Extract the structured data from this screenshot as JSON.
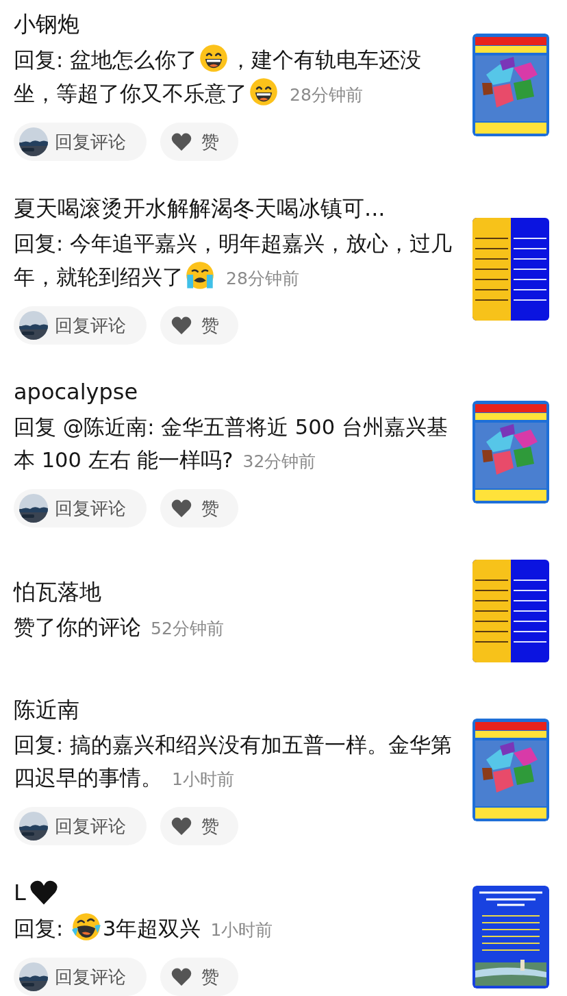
{
  "notifications": [
    {
      "name": [
        {
          "kind": "text",
          "text": "小钢炮"
        }
      ],
      "body": [
        {
          "kind": "text",
          "text": "回复: 盆地怎么你了"
        },
        {
          "kind": "grin"
        },
        {
          "kind": "text",
          "text": "，建个有轨电车还没坐，等超了你又不乐意了"
        },
        {
          "kind": "grin"
        }
      ],
      "time": "28分钟前",
      "actions": {
        "reply": "回复评论",
        "like": "赞"
      },
      "thumb": {
        "kind": "map"
      }
    },
    {
      "name": [
        {
          "kind": "text",
          "text": "夏天喝滚烫开水解解渴冬天喝冰镇可..."
        }
      ],
      "body": [
        {
          "kind": "text",
          "text": "回复: 今年追平嘉兴，明年超嘉兴，放心，过几年，就轮到绍兴了"
        },
        {
          "kind": "sob"
        }
      ],
      "time": "28分钟前",
      "actions": {
        "reply": "回复评论",
        "like": "赞"
      },
      "thumb": {
        "kind": "table"
      }
    },
    {
      "name": [
        {
          "kind": "text",
          "text": "apocalypse"
        }
      ],
      "body": [
        {
          "kind": "text",
          "text": "回复 @陈近南: 金华五普将近 500 台州嘉兴基本 100 左右 能一样吗?"
        }
      ],
      "time": "32分钟前",
      "actions": {
        "reply": "回复评论",
        "like": "赞"
      },
      "thumb": {
        "kind": "map"
      }
    },
    {
      "name": [
        {
          "kind": "text",
          "text": "怕瓦落地"
        }
      ],
      "body": [
        {
          "kind": "text",
          "text": "赞了你的评论"
        }
      ],
      "time": "52分钟前",
      "thumb": {
        "kind": "table"
      }
    },
    {
      "name": [
        {
          "kind": "text",
          "text": "陈近南"
        }
      ],
      "body": [
        {
          "kind": "text",
          "text": "回复: 搞的嘉兴和绍兴没有加五普一样。金华第四迟早的事情。"
        }
      ],
      "time": "1小时前",
      "actions": {
        "reply": "回复评论",
        "like": "赞"
      },
      "thumb": {
        "kind": "map"
      }
    },
    {
      "name": [
        {
          "kind": "text",
          "text": "L"
        },
        {
          "kind": "black-heart"
        }
      ],
      "body": [
        {
          "kind": "text",
          "text": "回复: "
        },
        {
          "kind": "rofl"
        },
        {
          "kind": "text",
          "text": "3年超双兴"
        }
      ],
      "time": "1小时前",
      "actions": {
        "reply": "回复评论",
        "like": "赞"
      },
      "thumb": {
        "kind": "poster"
      }
    }
  ]
}
